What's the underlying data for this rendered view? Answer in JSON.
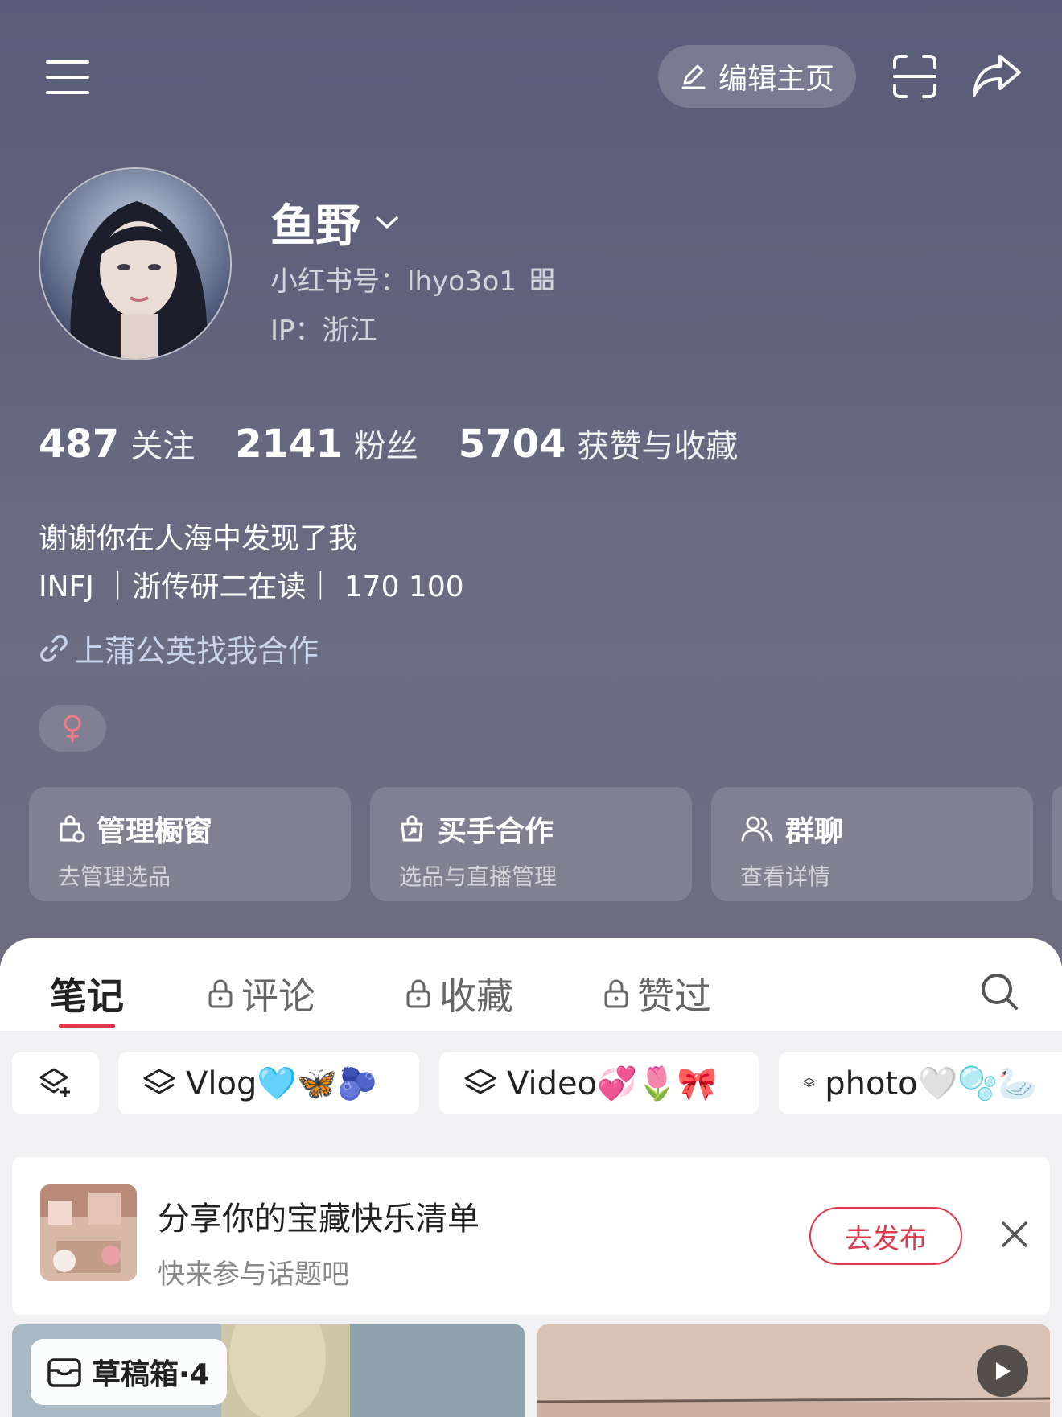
{
  "top_bar": {
    "edit_label": "编辑主页",
    "icons": [
      "menu-icon",
      "edit-pencil-icon",
      "scan-icon",
      "share-icon"
    ]
  },
  "profile": {
    "name": "鱼野",
    "id_line": "小红书号：lhyo3o1",
    "ip_line": "IP：浙江"
  },
  "stats": [
    {
      "num": "487",
      "label": "关注"
    },
    {
      "num": "2141",
      "label": "粉丝"
    },
    {
      "num": "5704",
      "label": "获赞与收藏"
    }
  ],
  "bio": {
    "line1": "谢谢你在人海中发现了我",
    "line2": "INFJ ｜浙传研二在读｜ 170 100"
  },
  "link_text": "上蒲公英找我合作",
  "cards": [
    {
      "title": "管理橱窗",
      "sub": "去管理选品"
    },
    {
      "title": "买手合作",
      "sub": "选品与直播管理"
    },
    {
      "title": "群聊",
      "sub": "查看详情"
    }
  ],
  "tabs": [
    {
      "label": "笔记"
    },
    {
      "label": "评论"
    },
    {
      "label": "收藏"
    },
    {
      "label": "赞过"
    }
  ],
  "collections": [
    {
      "label": "Vlog🩵🦋🫐"
    },
    {
      "label": "Video💞🌷🎀"
    },
    {
      "label": "photo🤍🫧🦢"
    }
  ],
  "promo": {
    "title": "分享你的宝藏快乐清单",
    "subtitle": "快来参与话题吧",
    "button": "去发布"
  },
  "draft_label": "草稿箱·4",
  "colors": {
    "accent_red": "#e03a4e",
    "link_blue": "#c9d3ee"
  }
}
